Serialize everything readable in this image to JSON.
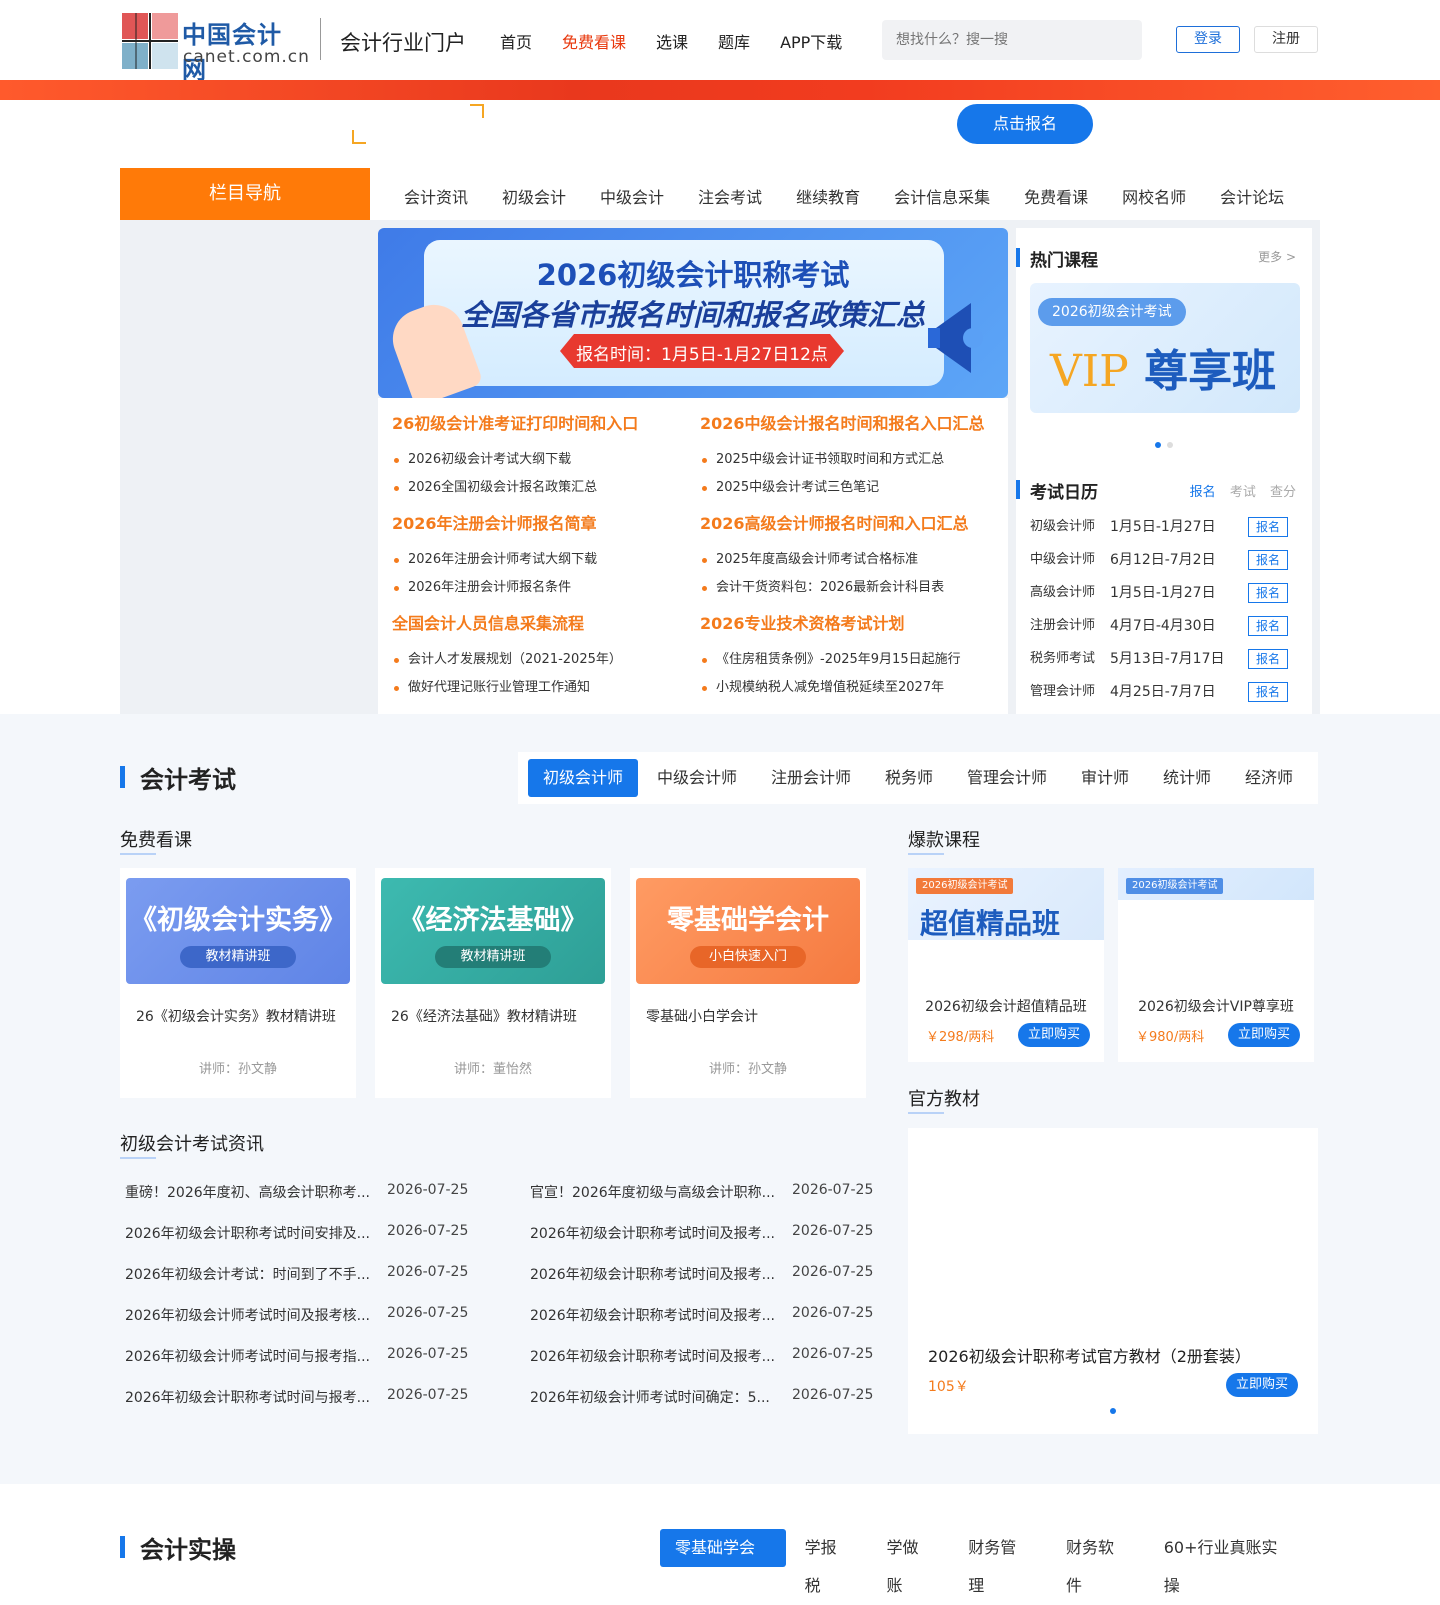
{
  "brand": {
    "name_cn": "中国会计网",
    "name_en": "canet.com.cn",
    "portal_title": "会计行业门户"
  },
  "topnav": [
    {
      "label": "首页"
    },
    {
      "label": "免费看课",
      "active": true
    },
    {
      "label": "选课"
    },
    {
      "label": "题库"
    },
    {
      "label": "APP下载"
    }
  ],
  "search": {
    "placeholder": "想找什么？搜一搜"
  },
  "auth": {
    "login": "登录",
    "register": "注册"
  },
  "cta": {
    "label": "点击报名"
  },
  "catnav": {
    "head": "栏目导航",
    "items": [
      "会计资讯",
      "初级会计",
      "中级会计",
      "注会考试",
      "继续教育",
      "会计信息采集",
      "免费看课",
      "网校名师",
      "会计论坛"
    ]
  },
  "banner": {
    "title1": "2026初级会计职称考试",
    "title2": "全国各省市报名时间和报名政策汇总",
    "time": "报名时间：1月5日-1月27日12点"
  },
  "news_groups": [
    {
      "title": "26初级会计准考证打印时间和入口",
      "items": [
        "2026初级会计考试大纲下载",
        "2026全国初级会计报名政策汇总"
      ]
    },
    {
      "title": "2026中级会计报名时间和报名入口汇总",
      "items": [
        "2025中级会计证书领取时间和方式汇总",
        "2025中级会计考试三色笔记"
      ]
    },
    {
      "title": "2026年注册会计师报名简章",
      "items": [
        "2026年注册会计师考试大纲下载",
        "2026年注册会计师报名条件"
      ]
    },
    {
      "title": "2026高级会计师报名时间和入口汇总",
      "items": [
        "2025年度高级会计师考试合格标准",
        "会计干货资料包：2026最新会计科目表"
      ]
    },
    {
      "title": "全国会计人员信息采集流程",
      "items": [
        "会计人才发展规划（2021-2025年）",
        "做好代理记账行业管理工作通知"
      ]
    },
    {
      "title": "2026专业技术资格考试计划",
      "items": [
        "《住房租赁条例》-2025年9月15日起施行",
        "小规模纳税人减免增值税延续至2027年"
      ]
    }
  ],
  "hot_courses": {
    "title": "热门课程",
    "more": "更多 >",
    "vip_tag": "2026初级会计考试",
    "vip_word": "VIP",
    "vip_text": "尊享班"
  },
  "calendar": {
    "title": "考试日历",
    "tabs": [
      "报名",
      "考试",
      "查分"
    ],
    "button": "报名",
    "rows": [
      {
        "name": "初级会计师",
        "date": "1月5日-1月27日"
      },
      {
        "name": "中级会计师",
        "date": "6月12日-7月2日"
      },
      {
        "name": "高级会计师",
        "date": "1月5日-1月27日"
      },
      {
        "name": "注册会计师",
        "date": "4月7日-4月30日"
      },
      {
        "name": "税务师考试",
        "date": "5月13日-7月17日"
      },
      {
        "name": "管理会计师",
        "date": "4月25日-7月7日"
      }
    ]
  },
  "exam": {
    "title": "会计考试",
    "tabs": [
      "初级会计师",
      "中级会计师",
      "注册会计师",
      "税务师",
      "管理会计师",
      "审计师",
      "统计师",
      "经济师"
    ],
    "free_title": "免费看课",
    "courses": [
      {
        "img_title": "《初级会计实务》",
        "img_sub": "教材精讲班",
        "name": "26《初级会计实务》教材精讲班",
        "teacher": "讲师：孙文静"
      },
      {
        "img_title": "《经济法基础》",
        "img_sub": "教材精讲班",
        "name": "26《经济法基础》教材精讲班",
        "teacher": "讲师：董怡然"
      },
      {
        "img_title": "零基础学会计",
        "img_sub": "小白快速入门",
        "name": "零基础小白学会计",
        "teacher": "讲师：孙文静"
      }
    ],
    "hot_title": "爆款课程",
    "hot": [
      {
        "tag": "2026初级会计考试",
        "img_text": "超值精品班",
        "name": "2026初级会计超值精品班",
        "price": "￥298/两科",
        "buy": "立即购买"
      },
      {
        "tag": "2026初级会计考试",
        "img_text": "",
        "name": "2026初级会计VIP尊享班",
        "price": "￥980/两科",
        "buy": "立即购买"
      }
    ],
    "news_title": "初级会计考试资讯",
    "news_left": [
      {
        "t": "重磅！2026年度初、高级会计职称考...",
        "d": "2026-07-25"
      },
      {
        "t": "2026年初级会计职称考试时间安排及...",
        "d": "2026-07-25"
      },
      {
        "t": "2026年初级会计考试：时间到了不手...",
        "d": "2026-07-25"
      },
      {
        "t": "2026年初级会计师考试时间及报考核...",
        "d": "2026-07-25"
      },
      {
        "t": "2026年初级会计师考试时间与报考指...",
        "d": "2026-07-25"
      },
      {
        "t": "2026年初级会计职称考试时间与报考...",
        "d": "2026-07-25"
      }
    ],
    "news_right": [
      {
        "t": "官宣！2026年度初级与高级会计职称...",
        "d": "2026-07-25"
      },
      {
        "t": "2026年初级会计职称考试时间及报考...",
        "d": "2026-07-25"
      },
      {
        "t": "2026年初级会计职称考试时间及报考...",
        "d": "2026-07-25"
      },
      {
        "t": "2026年初级会计职称考试时间及报考...",
        "d": "2026-07-25"
      },
      {
        "t": "2026年初级会计职称考试时间及报考...",
        "d": "2026-07-25"
      },
      {
        "t": "2026年初级会计师考试时间确定：5...",
        "d": "2026-07-25"
      }
    ],
    "book_title": "官方教材",
    "book": {
      "name": "2026初级会计职称考试官方教材（2册套装）",
      "price": "105￥",
      "buy": "立即购买"
    }
  },
  "practice": {
    "title": "会计实操",
    "tabs": [
      "零基础学会计",
      "学报税",
      "学做账",
      "财务管理",
      "财务软件",
      "60+行业真账实操"
    ]
  },
  "colors": {
    "accent": "#1677ea",
    "orange": "#ff7a08",
    "red": "#e8380d",
    "news_orange": "#f47b1c"
  }
}
